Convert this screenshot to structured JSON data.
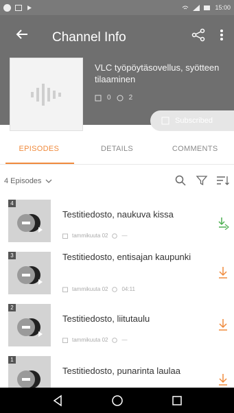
{
  "status_bar": {
    "time": "15:00"
  },
  "toolbar": {
    "title": "Channel Info"
  },
  "channel": {
    "name": "VLC työpöytäsovellus, syötteen tilaaminen",
    "episode_count": "0",
    "other_count": "2"
  },
  "subscribe": {
    "label": "Subscribed"
  },
  "tabs": [
    {
      "label": "EPISODES"
    },
    {
      "label": "DETAILS"
    },
    {
      "label": "COMMENTS"
    }
  ],
  "list_header": {
    "episodes_label": "4 Episodes"
  },
  "episodes": [
    {
      "number": "4",
      "title": "Testitiedosto, naukuva kissa",
      "date": "tammikuuta 02",
      "duration": "—"
    },
    {
      "number": "3",
      "title": "Testitiedosto, entisajan kaupunki",
      "date": "tammikuuta 02",
      "duration": "04:11"
    },
    {
      "number": "2",
      "title": "Testitiedosto, liitutaulu",
      "date": "tammikuuta 02",
      "duration": "—"
    },
    {
      "number": "1",
      "title": "Testitiedosto, punarinta laulaa",
      "date": "",
      "duration": ""
    }
  ],
  "colors": {
    "accent": "#f08a3c",
    "header_bg": "#6f6f6f",
    "download_green": "#4caf50"
  }
}
